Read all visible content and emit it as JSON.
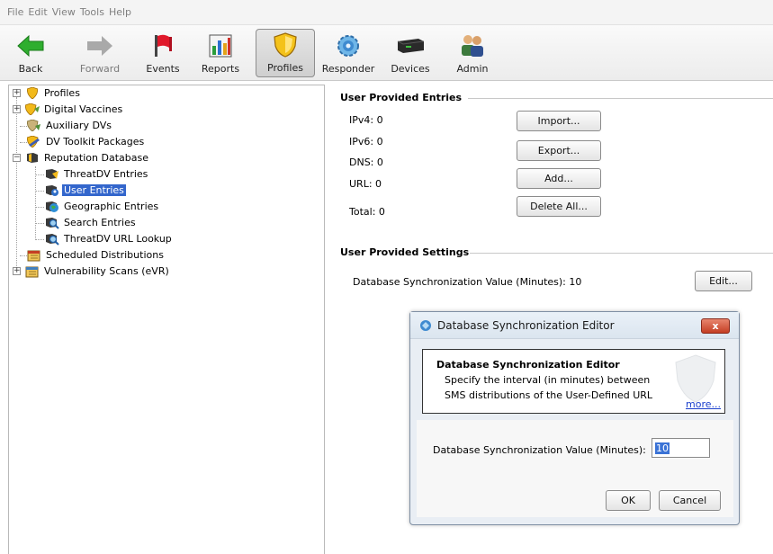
{
  "menu": [
    "File",
    "Edit",
    "View",
    "Tools",
    "Help"
  ],
  "toolbar": {
    "back": "Back",
    "forward": "Forward",
    "events": "Events",
    "reports": "Reports",
    "profiles": "Profiles",
    "responder": "Responder",
    "devices": "Devices",
    "admin": "Admin"
  },
  "tree": {
    "profiles": "Profiles",
    "digital_vaccines": "Digital Vaccines",
    "auxiliary_dvs": "Auxiliary DVs",
    "dv_toolkit": "DV Toolkit Packages",
    "reputation_db": "Reputation Database",
    "threatdv_entries": "ThreatDV Entries",
    "user_entries": "User Entries",
    "geographic_entries": "Geographic Entries",
    "search_entries": "Search Entries",
    "threatdv_url_lookup": "ThreatDV URL Lookup",
    "scheduled_distributions": "Scheduled Distributions",
    "vulnerability_scans": "Vulnerability Scans (eVR)"
  },
  "entries": {
    "title": "User Provided Entries",
    "ipv4": "IPv4:  0",
    "ipv6": "IPv6:  0",
    "dns": "DNS:  0",
    "url": "URL:  0",
    "total": "Total:  0",
    "import": "Import...",
    "export": "Export...",
    "add": "Add...",
    "delete_all": "Delete All..."
  },
  "settings": {
    "title": "User Provided Settings",
    "sync_label": "Database Synchronization Value (Minutes):  10",
    "edit": "Edit..."
  },
  "dialog": {
    "title": "Database Synchronization Editor",
    "close": "x",
    "heading": "Database Synchronization Editor",
    "desc_line1": "Specify the interval (in minutes) between",
    "desc_line2": "SMS distributions of the User-Defined URL",
    "more": "more...",
    "field_label": "Database Synchronization Value (Minutes):",
    "field_value": "10",
    "ok": "OK",
    "cancel": "Cancel"
  },
  "colors": {
    "selection": "#3366cc",
    "close_button": "#c43e24",
    "link": "#1a3fcc"
  }
}
